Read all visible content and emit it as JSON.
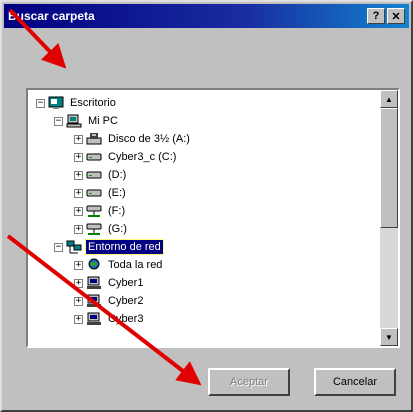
{
  "window": {
    "title": "Buscar carpeta",
    "help_button": "?",
    "close_button": "✕"
  },
  "tree": {
    "items": [
      {
        "label": "Escritorio",
        "icon": "desktop-icon",
        "expander": "−"
      },
      {
        "label": "Mi PC",
        "icon": "computer-icon",
        "expander": "−"
      },
      {
        "label": "Disco de 3½ (A:)",
        "icon": "floppy-drive-icon",
        "expander": "+"
      },
      {
        "label": "Cyber3_c (C:)",
        "icon": "hard-drive-icon",
        "expander": "+"
      },
      {
        "label": "(D:)",
        "icon": "hard-drive-icon",
        "expander": "+"
      },
      {
        "label": "(E:)",
        "icon": "hard-drive-icon",
        "expander": "+"
      },
      {
        "label": "(F:)",
        "icon": "network-drive-icon",
        "expander": "+"
      },
      {
        "label": "(G:)",
        "icon": "network-drive-icon",
        "expander": "+"
      },
      {
        "label": "Entorno de red",
        "icon": "network-neighborhood-icon",
        "expander": "−",
        "selected": true
      },
      {
        "label": "Toda la red",
        "icon": "entire-network-icon",
        "expander": "+"
      },
      {
        "label": "Cyber1",
        "icon": "network-computer-icon",
        "expander": "+"
      },
      {
        "label": "Cyber2",
        "icon": "network-computer-icon",
        "expander": "+"
      },
      {
        "label": "Cyber3",
        "icon": "network-computer-icon",
        "expander": "+"
      }
    ]
  },
  "buttons": {
    "accept": "Aceptar",
    "cancel": "Cancelar"
  },
  "colors": {
    "title_bar": "#000080",
    "selection": "#000080",
    "dialog_face": "#c0c0c0",
    "annotation_arrows": "#e00000"
  }
}
